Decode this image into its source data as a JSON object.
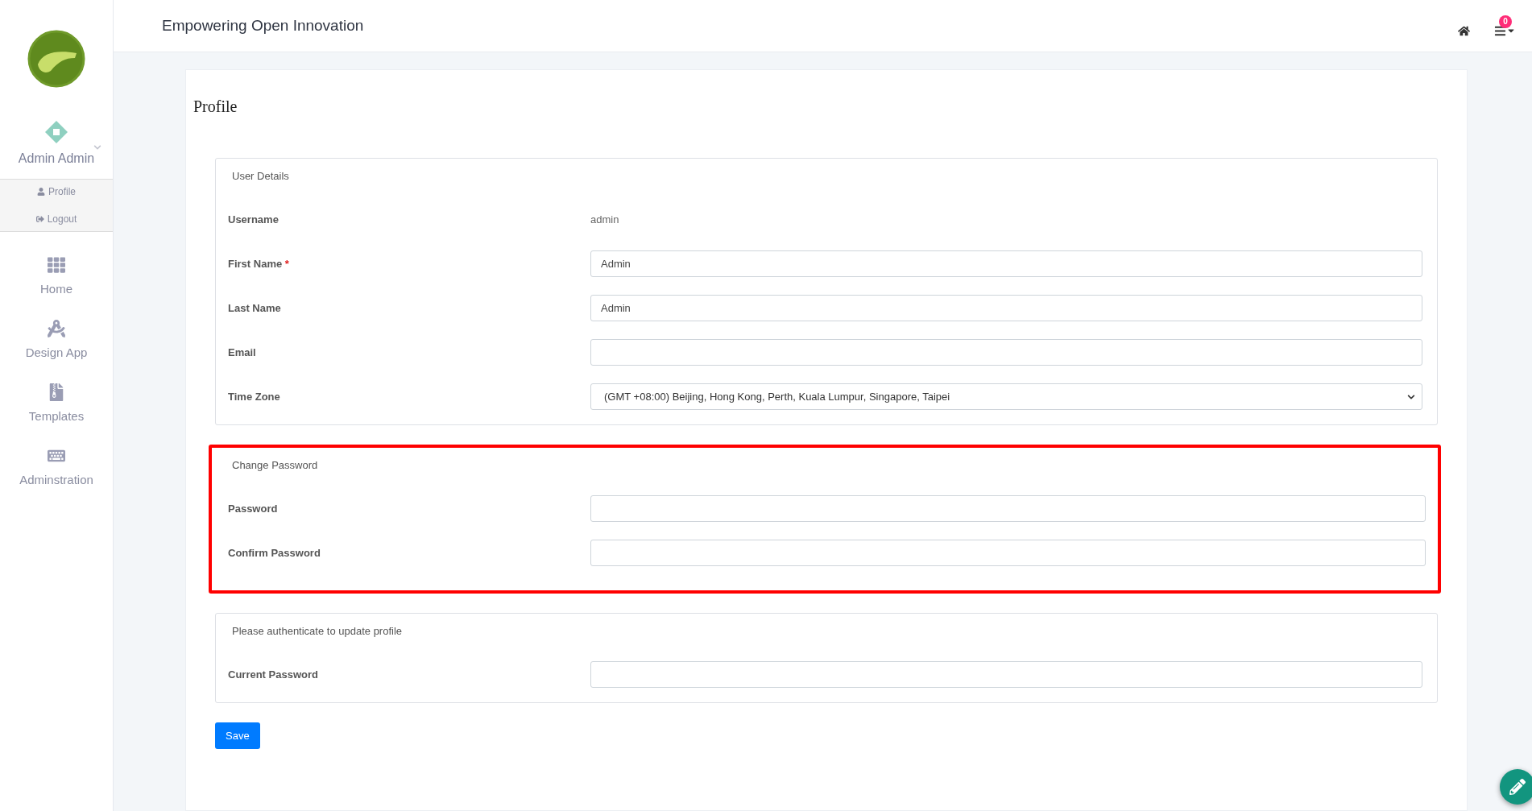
{
  "sidebar": {
    "user": {
      "name": "Admin Admin",
      "menu": [
        {
          "label": "Profile"
        },
        {
          "label": "Logout"
        }
      ]
    },
    "items": [
      {
        "label": "Home"
      },
      {
        "label": "Design App"
      },
      {
        "label": "Templates"
      },
      {
        "label": "Adminstration"
      }
    ]
  },
  "header": {
    "title": "Empowering Open Innovation",
    "notification_count": "0"
  },
  "page": {
    "title": "Profile",
    "sections": [
      {
        "legend": "User Details",
        "highlighted": false,
        "fields": [
          {
            "label": "Username",
            "kind": "text",
            "value": "admin"
          },
          {
            "label": "First Name",
            "kind": "input",
            "value": "Admin",
            "required_mark": "*"
          },
          {
            "label": "Last Name",
            "kind": "input",
            "value": "Admin"
          },
          {
            "label": "Email",
            "kind": "input"
          },
          {
            "label": "Time Zone",
            "kind": "select",
            "value": "(GMT +08:00) Beijing, Hong Kong, Perth, Kuala Lumpur, Singapore, Taipei"
          }
        ]
      },
      {
        "legend": "Change Password",
        "highlighted": true,
        "fields": [
          {
            "label": "Password",
            "kind": "input"
          },
          {
            "label": "Confirm Password",
            "kind": "input"
          }
        ]
      },
      {
        "legend": "Please authenticate to update profile",
        "highlighted": false,
        "fields": [
          {
            "label": "Current Password",
            "kind": "input"
          }
        ]
      }
    ],
    "save_button": "Save"
  }
}
